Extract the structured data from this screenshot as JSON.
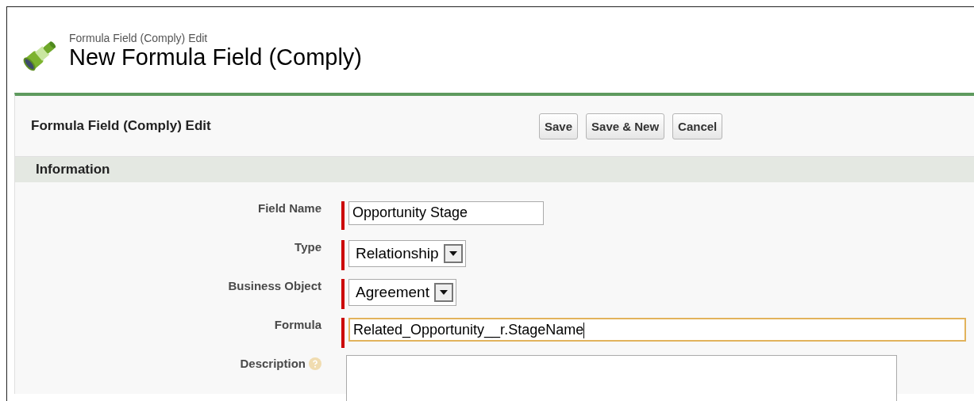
{
  "header": {
    "subtitle": "Formula Field (Comply) Edit",
    "title": "New Formula Field (Comply)"
  },
  "panel": {
    "title": "Formula Field (Comply) Edit",
    "buttons": [
      "Save",
      "Save & New",
      "Cancel"
    ]
  },
  "section": {
    "title": "Information"
  },
  "fields": [
    {
      "label": "Field Name",
      "kind": "text",
      "value": "Opportunity Stage",
      "required": true,
      "focused": false,
      "help": false
    },
    {
      "label": "Type",
      "kind": "select",
      "value": "Relationship",
      "required": true,
      "focused": false,
      "help": false
    },
    {
      "label": "Business Object",
      "kind": "select",
      "value": "Agreement",
      "required": true,
      "focused": false,
      "help": false
    },
    {
      "label": "Formula",
      "kind": "wide",
      "value": "Related_Opportunity__r.StageName",
      "required": true,
      "focused": true,
      "help": false
    },
    {
      "label": "Description",
      "kind": "textarea",
      "required": false,
      "focused": false,
      "help": true
    }
  ]
}
